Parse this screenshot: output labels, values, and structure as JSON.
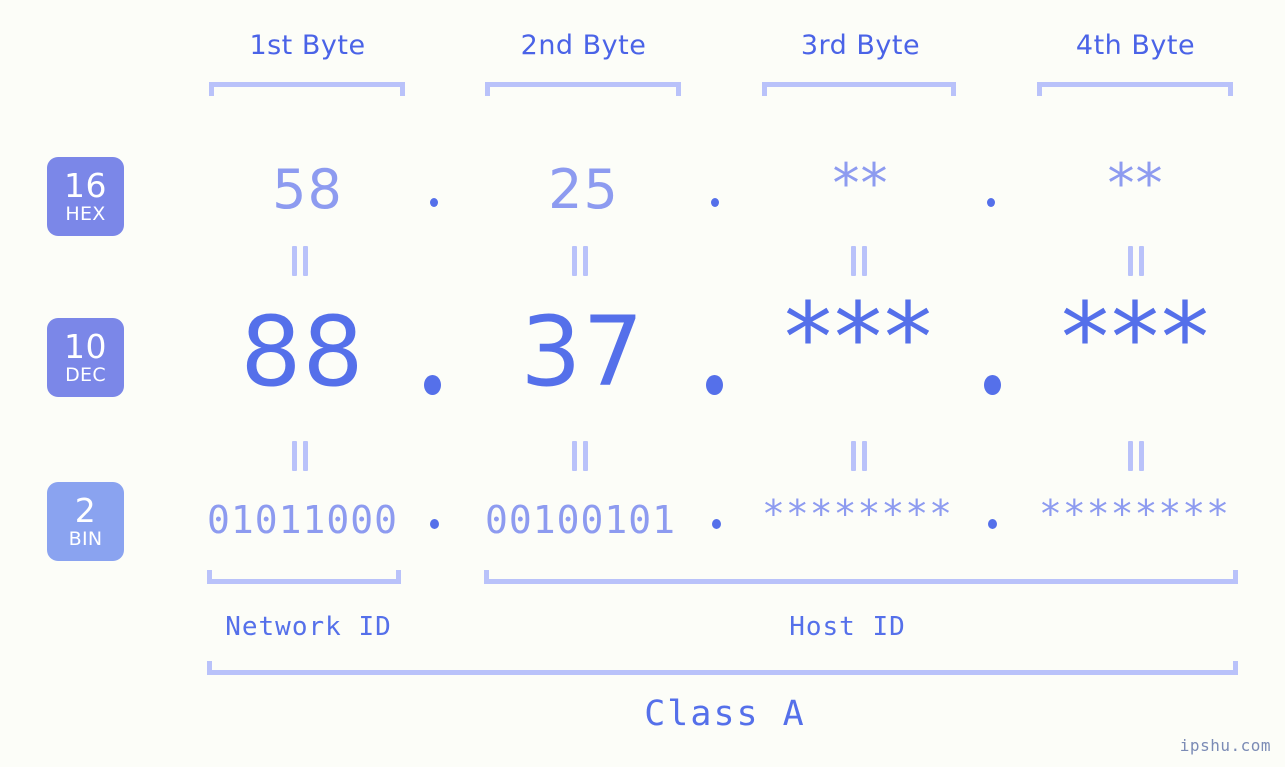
{
  "meta": {
    "background": "#fcfdf8",
    "accent": "#5570ea",
    "accent_light": "#8d9bf0",
    "bracket": "#b9c2fa",
    "badge_fill": "#7b87e8",
    "badge_fill_bin": "#8aa3f0"
  },
  "byte_headers": [
    {
      "label": "1st Byte"
    },
    {
      "label": "2nd Byte"
    },
    {
      "label": "3rd Byte"
    },
    {
      "label": "4th Byte"
    }
  ],
  "bases": [
    {
      "number": "16",
      "name": "HEX"
    },
    {
      "number": "10",
      "name": "DEC"
    },
    {
      "number": "2",
      "name": "BIN"
    }
  ],
  "rows": {
    "hex": {
      "base_number": "16",
      "base_name": "HEX",
      "values": [
        "58",
        "25",
        "**",
        "**"
      ]
    },
    "dec": {
      "base_number": "10",
      "base_name": "DEC",
      "values": [
        "88",
        "37",
        "***",
        "***"
      ]
    },
    "bin": {
      "base_number": "2",
      "base_name": "BIN",
      "values": [
        "01011000",
        "00100101",
        "********",
        "********"
      ]
    }
  },
  "separators": {
    "symbol": "."
  },
  "equals_connector": {
    "symbol": "||"
  },
  "sections": {
    "network_id": "Network ID",
    "host_id": "Host ID",
    "class": "Class A"
  },
  "watermark": "ipshu.com"
}
